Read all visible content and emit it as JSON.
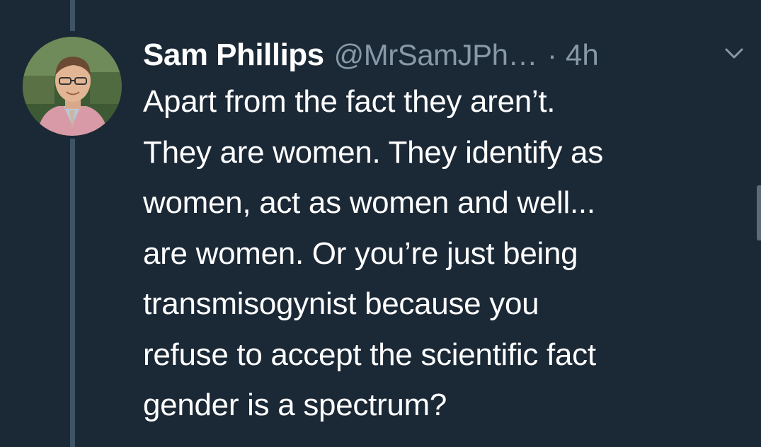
{
  "tweet": {
    "author_name": "Sam Phillips",
    "handle": "@MrSamJPh…",
    "separator": "·",
    "time": "4h",
    "text_lines": [
      "Apart from the fact they aren’t.",
      "They are women. They identify as",
      "women, act as women and well...",
      "are women. Or you’re just being",
      "transmisogynist because you",
      "refuse to accept the scientific fact",
      "gender is a spectrum?"
    ],
    "menu_icon": "chevron-down-icon",
    "avatar_icon": "avatar"
  },
  "colors": {
    "background": "#1b2836",
    "name": "#ffffff",
    "secondary": "#8899a6",
    "thread_line": "#3d5466"
  }
}
